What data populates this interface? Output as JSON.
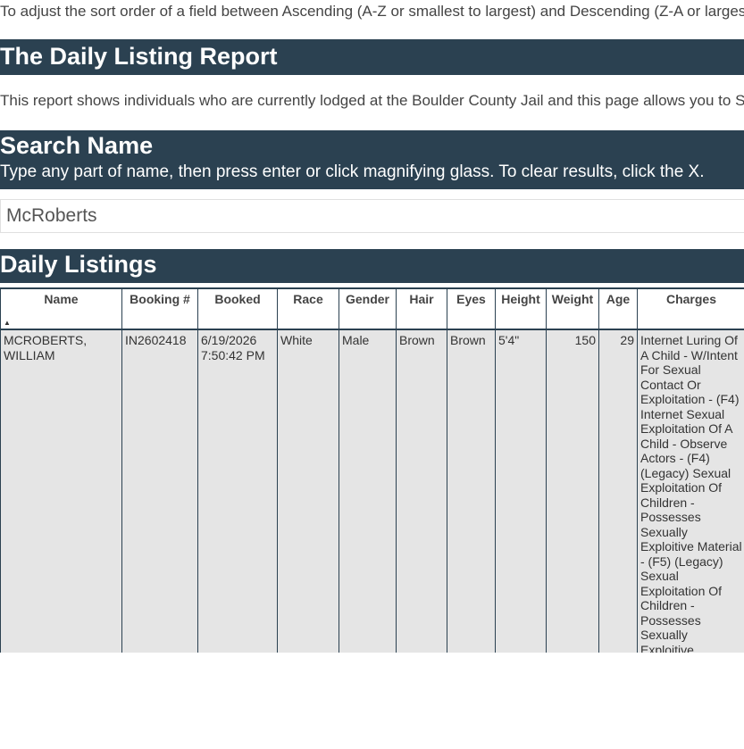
{
  "intro": {
    "sort_hint": "To adjust the sort order of a field between Ascending (A-Z or smallest to largest) and Descending (Z-A or largest"
  },
  "report": {
    "title": "The Daily Listing Report",
    "description": "This report shows individuals who are currently lodged at the Boulder County Jail and this page allows you to Se"
  },
  "search": {
    "title": "Search Name",
    "instructions": "Type any part of name, then press enter or click magnifying glass. To clear results, click the X.",
    "value": "McRoberts"
  },
  "listings": {
    "title": "Daily Listings",
    "columns": [
      "Name",
      "Booking #",
      "Booked",
      "Race",
      "Gender",
      "Hair",
      "Eyes",
      "Height",
      "Weight",
      "Age",
      "Charges"
    ],
    "sort_indicator": "▲",
    "rows": [
      {
        "name": "MCROBERTS, WILLIAM",
        "booking": "IN2602418",
        "booked": "6/19/2026 7:50:42 PM",
        "race": "White",
        "gender": "Male",
        "hair": "Brown",
        "eyes": "Brown",
        "height": "5'4\"",
        "weight": "150",
        "age": "29",
        "charges": "Internet Luring Of A Child - W/Intent For Sexual Contact Or Exploitation - (F4) Internet Sexual Exploitation Of A Child - Observe Actors - (F4) (Legacy) Sexual Exploitation Of Children - Possesses Sexually Exploitive Material - (F5) (Legacy) Sexual Exploitation Of Children - Possesses Sexually Exploitive"
      }
    ]
  },
  "colors": {
    "band": "#2b4151",
    "row_bg": "#e5e5e5"
  }
}
